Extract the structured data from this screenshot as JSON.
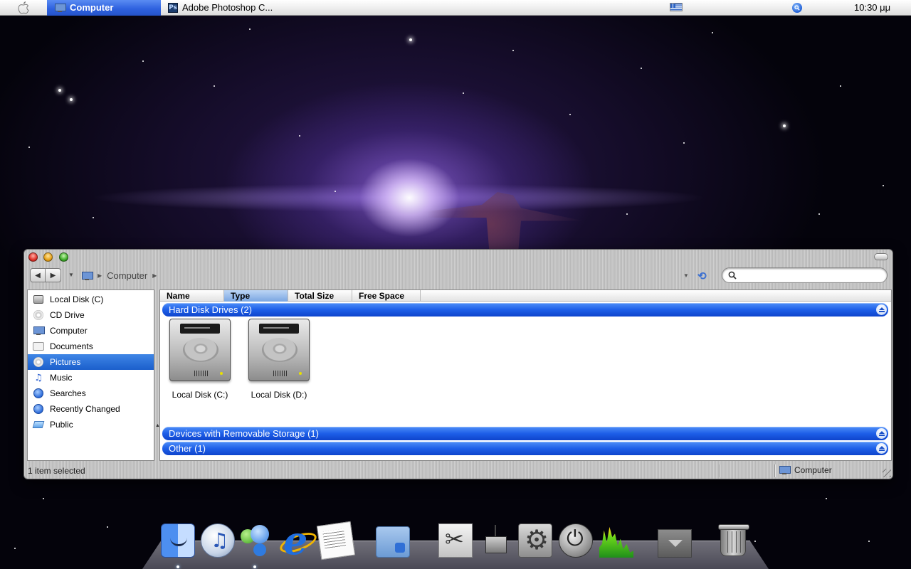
{
  "menubar": {
    "active_task": "Computer",
    "task2": "Adobe Photoshop C...",
    "ps_glyph": "Ps",
    "time": "10:30 μμ"
  },
  "window": {
    "breadcrumb": "Computer",
    "search_placeholder": "",
    "sidebar": [
      {
        "label": "Local Disk (C)",
        "icon": "hard-disk-icon",
        "selected": false
      },
      {
        "label": "CD Drive",
        "icon": "cd-drive-icon",
        "selected": false
      },
      {
        "label": "Computer",
        "icon": "computer-icon",
        "selected": false
      },
      {
        "label": "Documents",
        "icon": "documents-icon",
        "selected": false
      },
      {
        "label": "Pictures",
        "icon": "pictures-icon",
        "selected": true
      },
      {
        "label": "Music",
        "icon": "music-icon",
        "selected": false
      },
      {
        "label": "Searches",
        "icon": "searches-icon",
        "selected": false
      },
      {
        "label": "Recently Changed",
        "icon": "recently-changed-icon",
        "selected": false
      },
      {
        "label": "Public",
        "icon": "public-icon",
        "selected": false
      }
    ],
    "columns": [
      {
        "label": "Name",
        "sorted": false
      },
      {
        "label": "Type",
        "sorted": true
      },
      {
        "label": "Total Size",
        "sorted": false
      },
      {
        "label": "Free Space",
        "sorted": false
      }
    ],
    "groups": [
      {
        "label": "Hard Disk Drives (2)",
        "expanded": true
      },
      {
        "label": "Devices with Removable Storage (1)",
        "expanded": false
      },
      {
        "label": "Other (1)",
        "expanded": false
      }
    ],
    "drives": [
      {
        "label": "Local Disk (C:)"
      },
      {
        "label": "Local Disk (D:)"
      }
    ],
    "status": {
      "left": "1 item selected",
      "right": "Computer"
    }
  },
  "dock": {
    "items": [
      "finder-icon",
      "itunes-icon",
      "messenger-icon",
      "internet-explorer-icon",
      "textedit-icon",
      "folder-icon",
      "scissors-icon",
      "network-drive-icon",
      "system-preferences-icon",
      "power-icon",
      "activity-monitor-icon",
      "stack-icon",
      "trash-icon"
    ]
  },
  "colors": {
    "accent": "#1e5fe8",
    "selection": "#1b5fcc"
  }
}
